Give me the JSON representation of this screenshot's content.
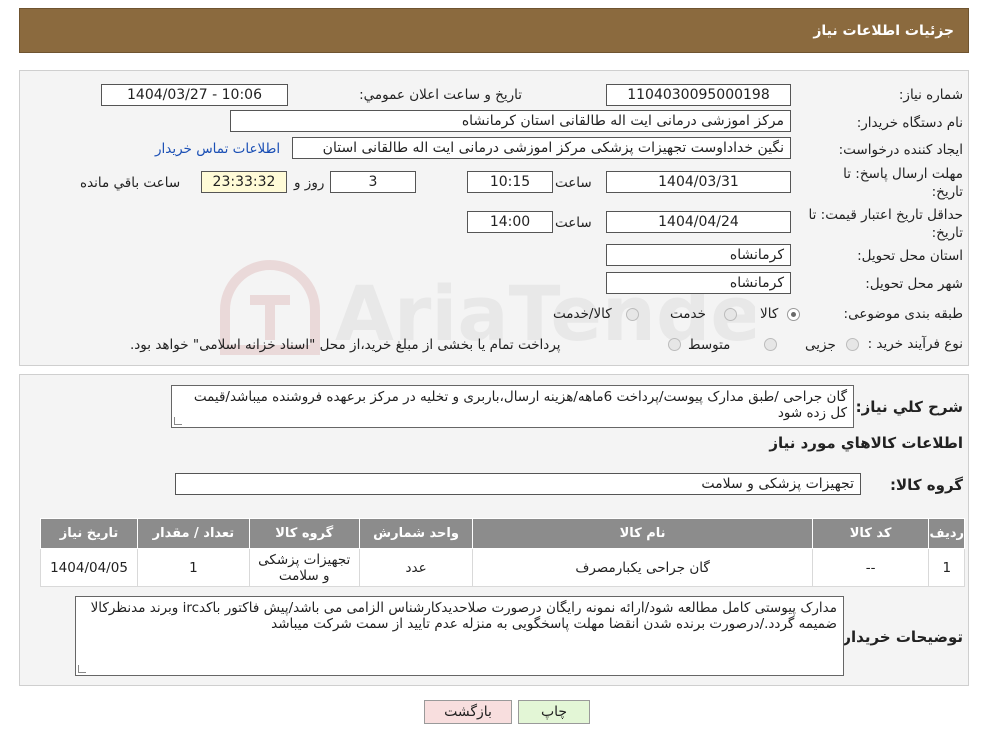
{
  "header": {
    "title": "جزئیات اطلاعات نیاز"
  },
  "form": {
    "need_number_label": "شماره نیاز:",
    "need_number_value": "1104030095000198",
    "announce_label": "تاریخ و ساعت اعلان عمومي:",
    "announce_value": "1404/03/27 - 10:06",
    "buyer_org_label": "نام دستگاه خریدار:",
    "buyer_org_value": "مرکز اموزشی درمانی ایت اله طالقانی استان کرمانشاه",
    "creator_label": "ایجاد کننده درخواست:",
    "creator_value": "نگین خداداوست تجهیزات پزشکی مرکز اموزشی درمانی ایت اله طالقانی استان",
    "contact_link": "اطلاعات تماس خریدار",
    "deadline_label": "مهلت ارسال پاسخ: تا تاریخ:",
    "deadline_date": "1404/03/31",
    "time_label": "ساعت",
    "deadline_time": "10:15",
    "days_value": "3",
    "days_label": "روز و",
    "remaining_value": "23:33:32",
    "remaining_label": "ساعت باقي مانده",
    "validity_label": "حداقل تاریخ اعتبار قیمت: تا تاریخ:",
    "validity_date": "1404/04/24",
    "validity_time": "14:00",
    "province_label": "استان محل تحویل:",
    "province_value": "کرمانشاه",
    "city_label": "شهر محل تحویل:",
    "city_value": "کرمانشاه",
    "category_label": "طبقه بندی موضوعی:",
    "category_options": [
      "کالا",
      "خدمت",
      "کالا/خدمت"
    ],
    "process_label": "نوع فرآیند خرید :",
    "process_options": [
      "جزیی",
      "متوسط"
    ],
    "process_note": "پرداخت تمام یا بخشی از مبلغ خرید،از محل \"اسناد خزانه اسلامی\" خواهد بود."
  },
  "details": {
    "summary_label": "شرح کلي نیاز:",
    "summary_text": "گان جراحی /طبق مدارک پیوست/پرداخت 6ماهه/هزینه ارسال،باربری و تخلیه در مرکز برعهده فروشنده میباشد/قیمت کل زده شود",
    "goods_info_title": "اطلاعات کالاهاي مورد نیاز",
    "goods_group_label": "گروه کالا:",
    "goods_group_value": "تجهیزات پزشکی و سلامت",
    "table": {
      "headers": [
        "ردیف",
        "کد کالا",
        "نام کالا",
        "واحد شمارش",
        "گروه کالا",
        "تعداد / مقدار",
        "تاریخ نیاز"
      ],
      "rows": [
        [
          "1",
          "--",
          "گان جراحی یکبارمصرف",
          "عدد",
          "تجهیزات پزشکی و سلامت",
          "1",
          "1404/04/05"
        ]
      ]
    },
    "buyer_notes_label": "توضیحات خریدار:",
    "buyer_notes_text": "مدارک پیوستی کامل مطالعه شود/ارائه نمونه رایگان درصورت صلاحدیدکارشناس الزامی می باشد/پیش فاکتور باکدirc وبرند مدنظرکالا ضمیمه گردد./درصورت برنده شدن انقضا مهلت پاسخگویی به منزله عدم تایید از سمت شرکت میباشد"
  },
  "buttons": {
    "print": "چاپ",
    "back": "بازگشت"
  },
  "watermark": {
    "text": "AriaTender.neT"
  },
  "colors": {
    "header_bg": "#8b6a3e",
    "table_header_bg": "#8c8c8c",
    "print_btn_bg": "#e3f6d6",
    "back_btn_bg": "#f8dede",
    "timer_bg": "#fffbd7"
  }
}
